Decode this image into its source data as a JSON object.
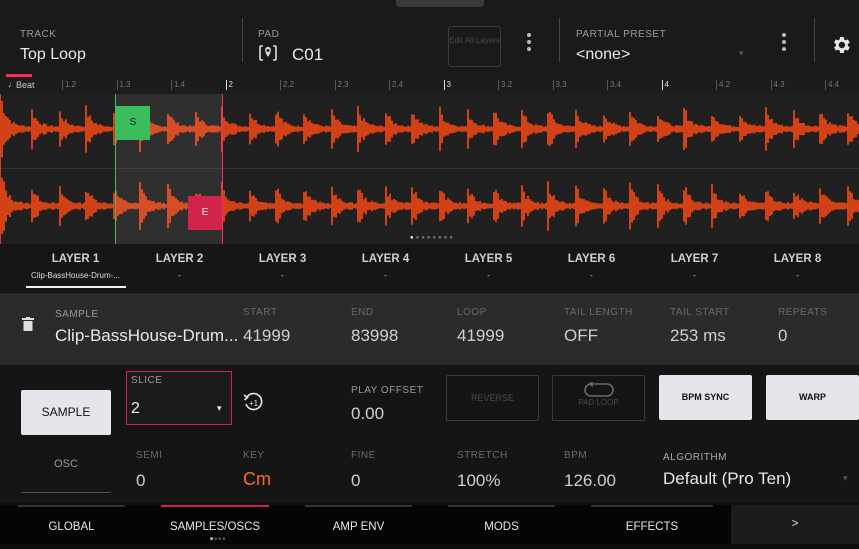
{
  "header": {
    "track_label": "TRACK",
    "track_value": "Top Loop",
    "pad_label": "PAD",
    "pad_value": "C01",
    "edit_all_layers": "Edit All Layers",
    "partial_preset_label": "PARTIAL PRESET",
    "partial_preset_value": "<none>"
  },
  "waveform": {
    "beat_label": "Beat",
    "ruler": [
      "1.2",
      "1.3",
      "1.4",
      "2",
      "2.2",
      "2.3",
      "2.4",
      "3",
      "3.2",
      "3.3",
      "3.4",
      "4",
      "4.2",
      "4.3",
      "4.4"
    ],
    "slice_start_marker": "S",
    "slice_end_marker": "E",
    "colors": {
      "wave": "#ff4a14",
      "start": "#3bbd5c",
      "end": "#e0244e",
      "line": "#ff2a55"
    }
  },
  "layers": [
    {
      "label": "LAYER 1",
      "sample": "Clip-BassHouse-Drum-..."
    },
    {
      "label": "LAYER 2",
      "sample": "-"
    },
    {
      "label": "LAYER 3",
      "sample": "-"
    },
    {
      "label": "LAYER 4",
      "sample": "-"
    },
    {
      "label": "LAYER 5",
      "sample": "-"
    },
    {
      "label": "LAYER 6",
      "sample": "-"
    },
    {
      "label": "LAYER 7",
      "sample": "-"
    },
    {
      "label": "LAYER 8",
      "sample": "-"
    }
  ],
  "sample_row": {
    "sample_label": "SAMPLE",
    "sample_value": "Clip-BassHouse-Drum...",
    "start_label": "START",
    "start_value": "41999",
    "end_label": "END",
    "end_value": "83998",
    "loop_label": "LOOP",
    "loop_value": "41999",
    "tail_length_label": "TAIL LENGTH",
    "tail_length_value": "OFF",
    "tail_start_label": "TAIL START",
    "tail_start_value": "253 ms",
    "repeats_label": "REPEATS",
    "repeats_value": "0"
  },
  "controls": {
    "sample_button": "SAMPLE",
    "slice_label": "SLICE",
    "slice_value": "2",
    "play_offset_label": "PLAY OFFSET",
    "play_offset_value": "0.00",
    "reverse": "REVERSE",
    "pad_loop": "PAD LOOP",
    "bpm_sync": "BPM SYNC",
    "warp": "WARP",
    "osc_button": "OSC",
    "semi_label": "SEMI",
    "semi_value": "0",
    "key_label": "KEY",
    "key_value": "Cm",
    "fine_label": "FINE",
    "fine_value": "0",
    "stretch_label": "STRETCH",
    "stretch_value": "100%",
    "bpm_label": "BPM",
    "bpm_value": "126.00",
    "algorithm_label": "ALGORITHM",
    "algorithm_value": "Default (Pro Ten)"
  },
  "footer": {
    "tabs": [
      "GLOBAL",
      "SAMPLES/OSCS",
      "AMP ENV",
      "MODS",
      "EFFECTS",
      ">"
    ]
  }
}
